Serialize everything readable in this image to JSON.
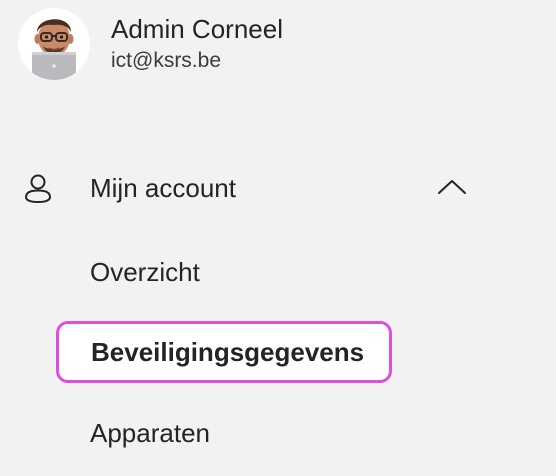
{
  "profile": {
    "name": "Admin Corneel",
    "email": "ict@ksrs.be"
  },
  "nav": {
    "section_label": "Mijn account",
    "section_icon": "person-icon",
    "section_expanded": true,
    "collapse_icon": "chevron-up-icon",
    "items": [
      {
        "label": "Overzicht",
        "selected": false
      },
      {
        "label": "Beveiligingsgegevens",
        "selected": true
      },
      {
        "label": "Apparaten",
        "selected": false
      }
    ]
  },
  "colors": {
    "background": "#f2f2f2",
    "selection_outline": "#e04ee0",
    "text": "#242424"
  }
}
